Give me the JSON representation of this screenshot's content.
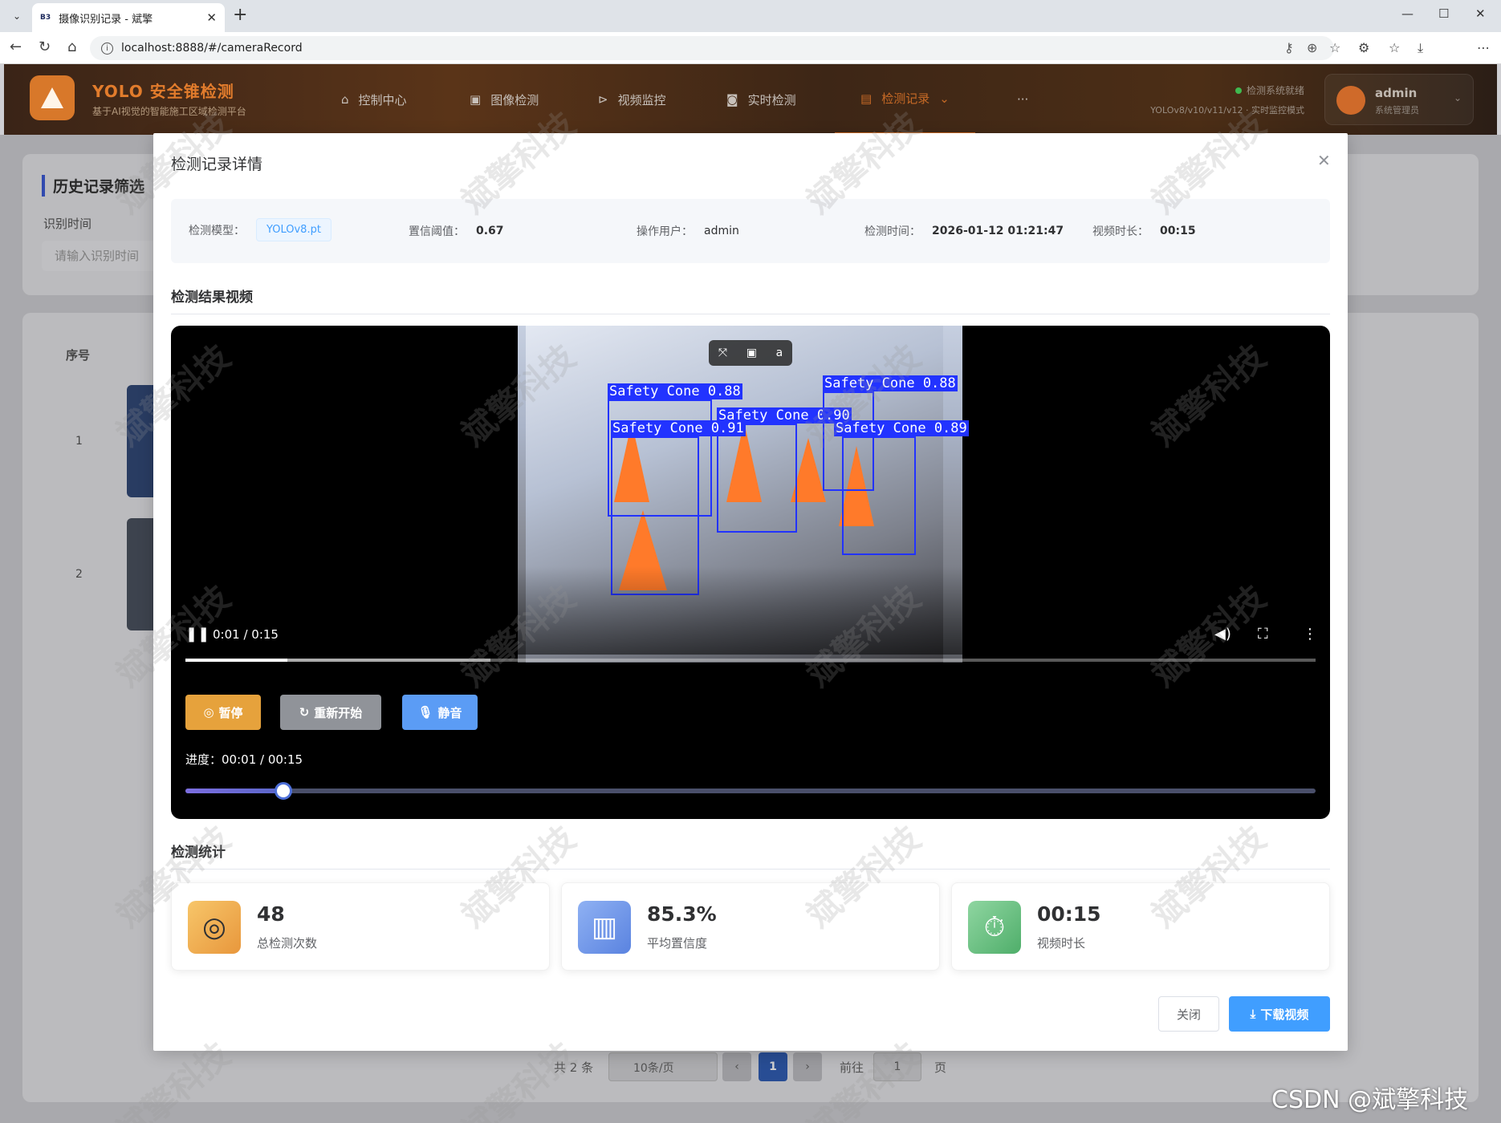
{
  "browser": {
    "tab_title": "摄像识别记录 - 斌擎",
    "tab_favicon": "B3",
    "url": "localhost:8888/#/cameraRecord"
  },
  "app": {
    "brand": "YOLO 安全锥检测",
    "brand_sub": "基于AI视觉的智能施工区域检测平台",
    "nav": [
      {
        "label": "控制中心",
        "icon": "home-icon"
      },
      {
        "label": "图像检测",
        "icon": "image-icon"
      },
      {
        "label": "视频监控",
        "icon": "play-circle-icon"
      },
      {
        "label": "实时检测",
        "icon": "camera-icon"
      },
      {
        "label": "检测记录",
        "icon": "document-icon",
        "active": true
      }
    ],
    "more": "···",
    "status_label": "检测系统就绪",
    "status_sub": "YOLOv8/v10/v11/v12 · 实时监控模式",
    "user_name": "admin",
    "user_role": "系统管理员"
  },
  "background_page": {
    "filter_title": "历史记录筛选",
    "filter_label": "识别时间",
    "filter_placeholder": "请输入识别时间",
    "col_index": "序号",
    "rows": [
      "1",
      "2"
    ],
    "total": "共 2 条",
    "page_size": "10条/页",
    "current_page": "1",
    "goto_label": "前往",
    "goto_value": "1",
    "page_unit": "页"
  },
  "modal": {
    "title": "检测记录详情",
    "info": {
      "model_label": "检测模型：",
      "model_value": "YOLOv8.pt",
      "conf_label": "置信阈值：",
      "conf_value": "0.67",
      "user_label": "操作用户：",
      "user_value": "admin",
      "time_label": "检测时间：",
      "time_value": "2026-01-12 01:21:47",
      "duration_label": "视频时长：",
      "duration_value": "00:15"
    },
    "video_section_title": "检测结果视频",
    "video": {
      "time_display": "0:01 / 0:15",
      "played_fraction": 0.09,
      "buffered_fraction": 0.27,
      "detections": [
        {
          "label": "Safety Cone 0.88"
        },
        {
          "label": "Safety Cone 0.90"
        },
        {
          "label": "Safety Cone 0.91"
        },
        {
          "label": "Safety Cone 0.88"
        },
        {
          "label": "Safety Cone 0.89"
        }
      ]
    },
    "controls": {
      "pause_label": "暂停",
      "restart_label": "重新开始",
      "mute_label": "静音",
      "progress_label": "进度：",
      "progress_value": "00:01 / 00:15",
      "slider_fraction": 0.087
    },
    "stats_section_title": "检测统计",
    "stats": [
      {
        "value": "48",
        "label": "总检测次数",
        "icon": "target-icon"
      },
      {
        "value": "85.3%",
        "label": "平均置信度",
        "icon": "bar-chart-icon"
      },
      {
        "value": "00:15",
        "label": "视频时长",
        "icon": "stopwatch-icon"
      }
    ],
    "close_label": "关闭",
    "download_label": "下载视频"
  },
  "watermark_text": "斌擎科技",
  "footer_watermark": "CSDN @斌擎科技",
  "colors": {
    "brand_orange": "#e27c2c",
    "primary_blue": "#409eff",
    "pause_yellow": "#e6a23c",
    "restart_gray": "#909399",
    "mute_blue": "#5b9cf5",
    "box_blue": "#2233ff"
  }
}
